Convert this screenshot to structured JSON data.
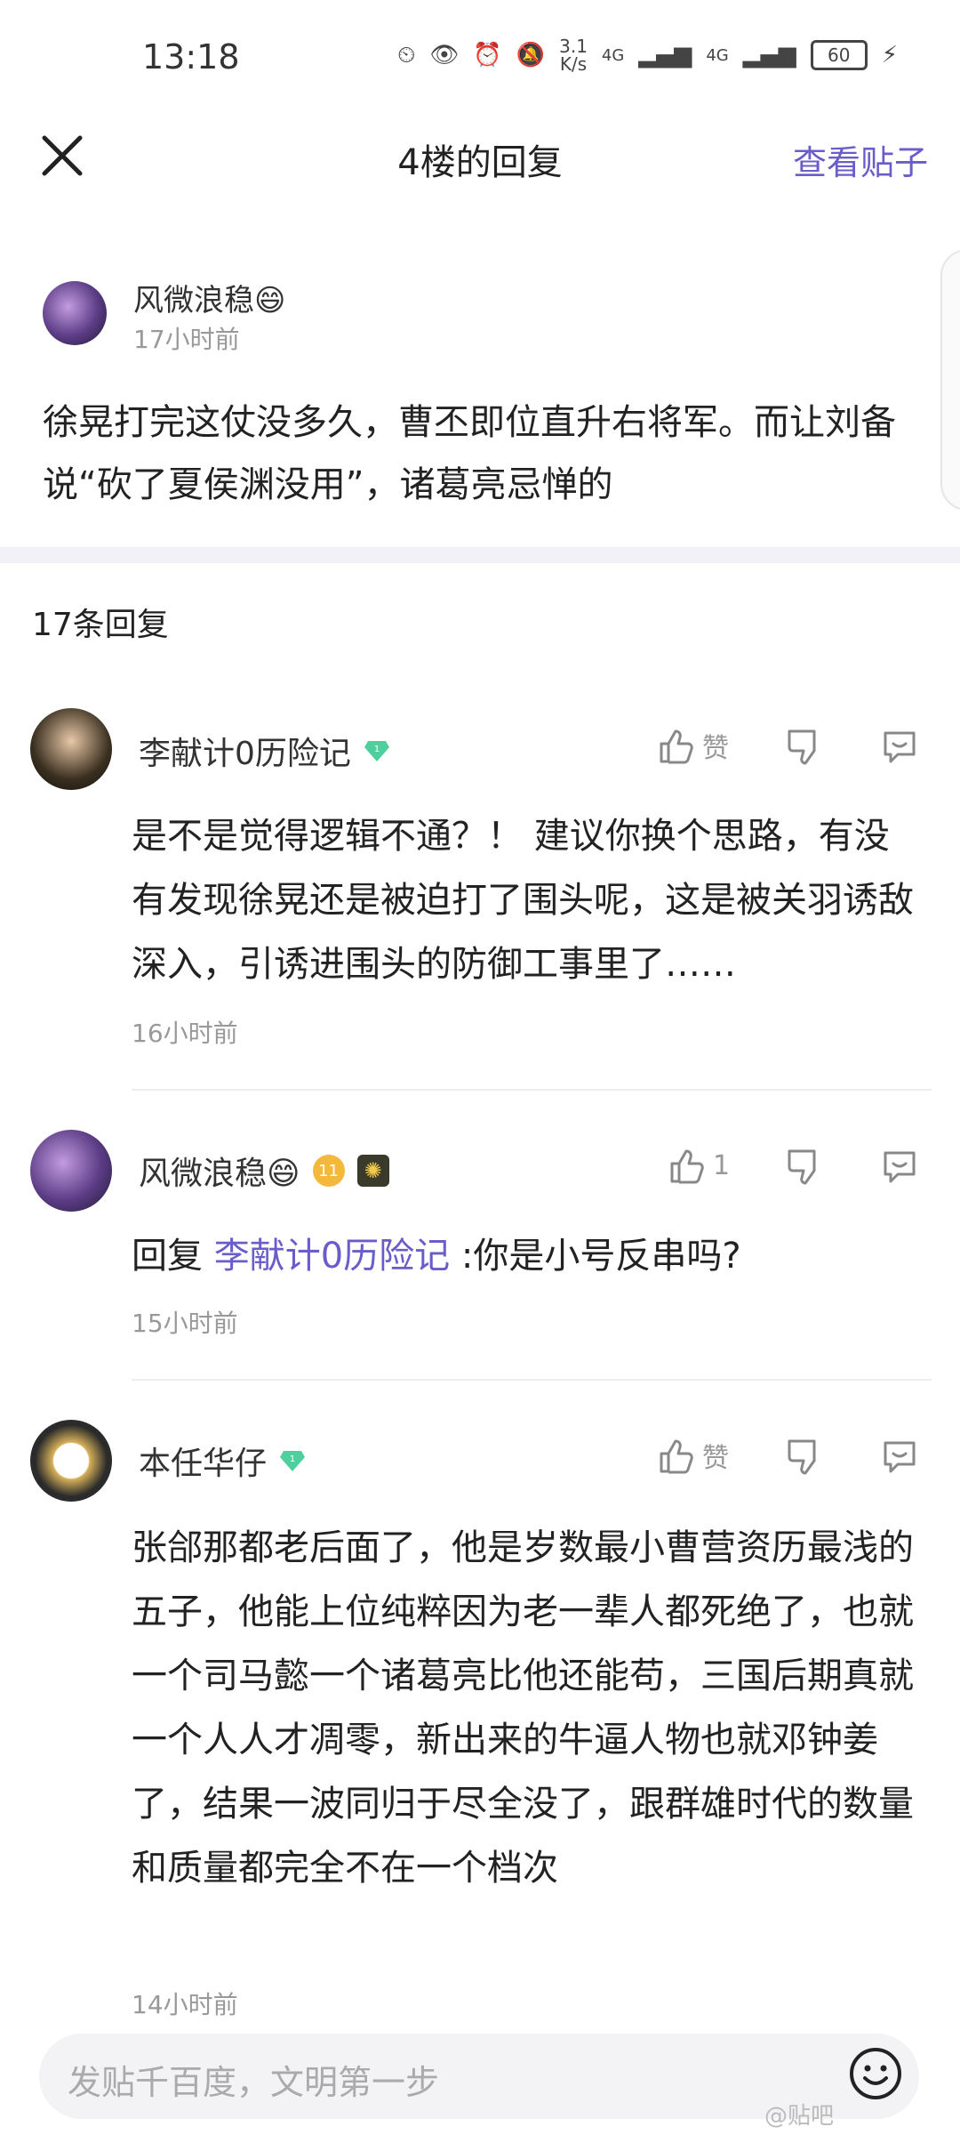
{
  "status": {
    "time": "13:18",
    "speed_top": "3.1",
    "speed_bottom": "K/s",
    "network1": "4G",
    "network2": "4G",
    "battery": "60"
  },
  "header": {
    "title": "4楼的回复",
    "view_post": "查看贴子"
  },
  "post": {
    "author": "风微浪稳😄",
    "time": "17小时前",
    "content": "徐晃打完这仗没多久，曹丕即位直升右将军。而让刘备说“砍了夏侯渊没用”，诸葛亮忌惮的"
  },
  "reply_count": "17条回复",
  "replies": [
    {
      "author": "李献计0历险记",
      "badge_level": "1",
      "like": "赞",
      "text": "是不是觉得逻辑不通？！ 建议你换个思路，有没有发现徐晃还是被迫打了围头呢，这是被关羽诱敌深入，引诱进围头的防御工事里了……",
      "time": "16小时前"
    },
    {
      "author": "风微浪稳😄",
      "badge_level": "11",
      "like": "1",
      "reply_prefix": "回复",
      "mention": "李献计0历险记",
      "text": ":你是小号反串吗?",
      "time": "15小时前"
    },
    {
      "author": "本任华仔",
      "badge_level": "1",
      "like": "赞",
      "text": "张郃那都老后面了，他是岁数最小曹营资历最浅的五子，他能上位纯粹因为老一辈人都死绝了，也就一个司马懿一个诸葛亮比他还能苟，三国后期真就一个人人才凋零，新出来的牛逼人物也就邓钟姜了，结果一波同归于尽全没了，跟群雄时代的数量和质量都完全不在一个档次",
      "time": "14小时前"
    }
  ],
  "input": {
    "placeholder": "发贴千百度，文明第一步"
  },
  "watermark": "@贴吧"
}
